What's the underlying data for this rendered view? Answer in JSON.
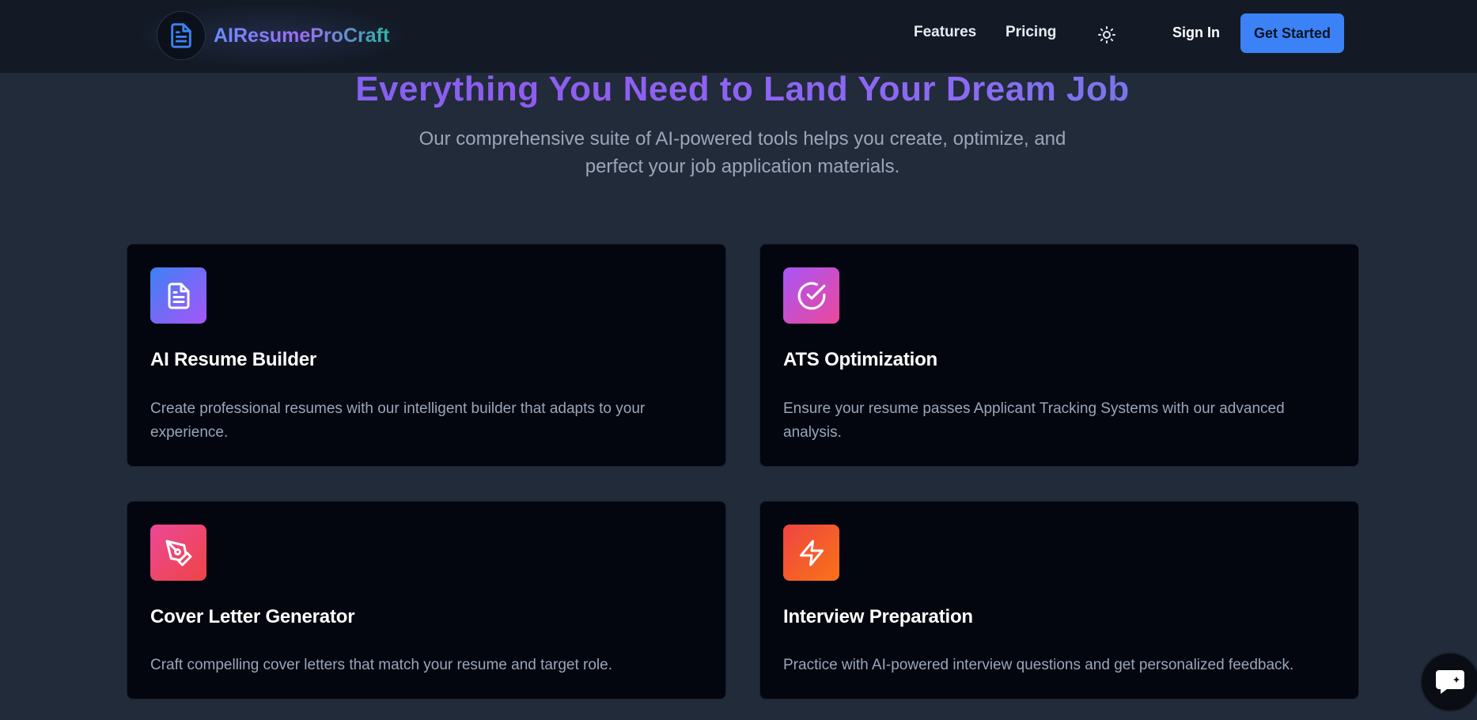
{
  "brand": {
    "name": "AIResumeProCraft"
  },
  "nav": {
    "features": "Features",
    "pricing": "Pricing",
    "sign_in": "Sign In",
    "get_started": "Get Started"
  },
  "hero": {
    "title": "Everything You Need to Land Your Dream Job",
    "subtitle": "Our comprehensive suite of AI-powered tools helps you create, optimize, and perfect your job application materials."
  },
  "features": [
    {
      "icon": "document-icon",
      "title": "AI Resume Builder",
      "description": "Create professional resumes with our intelligent builder that adapts to your experience.",
      "gradient": [
        "#3b82f6",
        "#a855f7"
      ]
    },
    {
      "icon": "check-circle-icon",
      "title": "ATS Optimization",
      "description": "Ensure your resume passes Applicant Tracking Systems with our advanced analysis.",
      "gradient": [
        "#a855f7",
        "#ec4899"
      ]
    },
    {
      "icon": "pen-tool-icon",
      "title": "Cover Letter Generator",
      "description": "Craft compelling cover letters that match your resume and target role.",
      "gradient": [
        "#ec4899",
        "#ef4444"
      ]
    },
    {
      "icon": "lightning-icon",
      "title": "Interview Preparation",
      "description": "Practice with AI-powered interview questions and get personalized feedback.",
      "gradient": [
        "#ef4444",
        "#f97316"
      ]
    }
  ],
  "colors": {
    "page_bg": "#222b3a",
    "nav_bg": "#131a26",
    "card_bg": "#03060f",
    "accent": "#3b82f6"
  }
}
